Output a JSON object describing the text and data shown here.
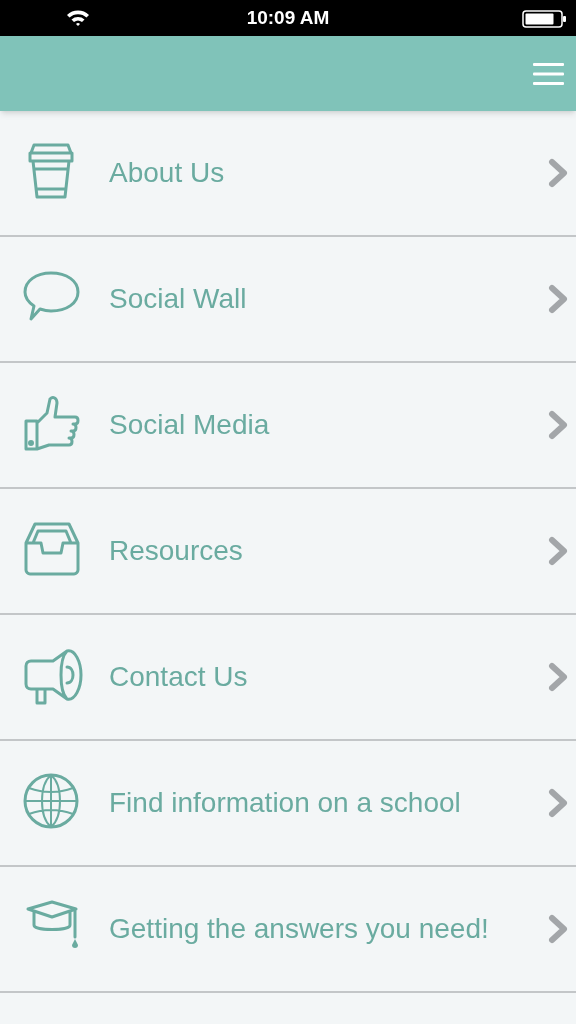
{
  "status_bar": {
    "time": "10:09 AM"
  },
  "menu_items": [
    {
      "kind": "cup",
      "label": "About Us"
    },
    {
      "kind": "speech",
      "label": "Social Wall"
    },
    {
      "kind": "thumb",
      "label": "Social Media"
    },
    {
      "kind": "tray",
      "label": "Resources"
    },
    {
      "kind": "megaphone",
      "label": "Contact Us"
    },
    {
      "kind": "globe",
      "label": "Find information on a school"
    },
    {
      "kind": "cap",
      "label": "Getting the answers you need!"
    }
  ]
}
